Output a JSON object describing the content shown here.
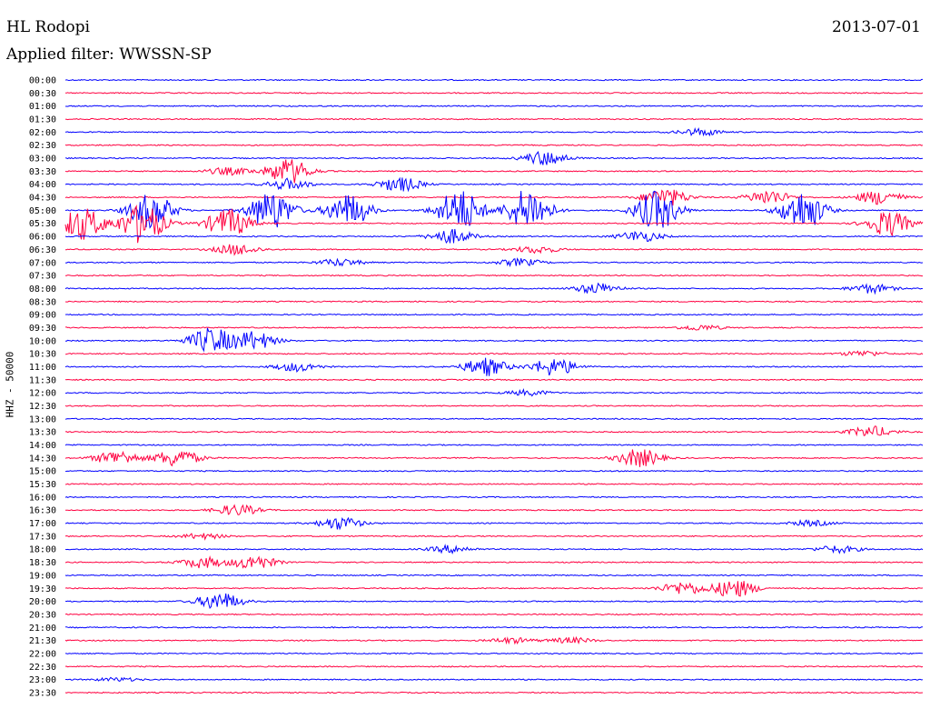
{
  "header": {
    "station": "HL Rodopi",
    "date": "2013-07-01",
    "filter": "Applied filter: WWSSN-SP"
  },
  "chart_data": {
    "type": "line",
    "title": "HL Rodopi",
    "subtitle": "Applied filter: WWSSN-SP",
    "ylabel": "HHZ - 50000",
    "xlabel": "",
    "grid": false,
    "row_colors": [
      "#0000ff",
      "#ff0040"
    ],
    "rows": [
      {
        "time": "00:00",
        "events": []
      },
      {
        "time": "00:30",
        "events": []
      },
      {
        "time": "01:00",
        "events": []
      },
      {
        "time": "01:30",
        "events": []
      },
      {
        "time": "02:00",
        "events": [
          {
            "x": 0.74,
            "a": 4
          }
        ]
      },
      {
        "time": "02:30",
        "events": []
      },
      {
        "time": "03:00",
        "events": [
          {
            "x": 0.56,
            "a": 8
          }
        ]
      },
      {
        "time": "03:30",
        "events": [
          {
            "x": 0.19,
            "a": 4
          },
          {
            "x": 0.26,
            "a": 14
          }
        ]
      },
      {
        "time": "04:00",
        "events": [
          {
            "x": 0.26,
            "a": 6
          },
          {
            "x": 0.39,
            "a": 8
          }
        ]
      },
      {
        "time": "04:30",
        "events": [
          {
            "x": 0.7,
            "a": 10
          },
          {
            "x": 0.82,
            "a": 8
          },
          {
            "x": 0.95,
            "a": 8
          }
        ]
      },
      {
        "time": "05:00",
        "events": [
          {
            "x": 0.1,
            "a": 20
          },
          {
            "x": 0.24,
            "a": 22
          },
          {
            "x": 0.33,
            "a": 18
          },
          {
            "x": 0.46,
            "a": 24
          },
          {
            "x": 0.54,
            "a": 24
          },
          {
            "x": 0.69,
            "a": 22
          },
          {
            "x": 0.86,
            "a": 22
          }
        ]
      },
      {
        "time": "05:30",
        "events": [
          {
            "x": 0.02,
            "a": 18
          },
          {
            "x": 0.09,
            "a": 22
          },
          {
            "x": 0.19,
            "a": 16
          },
          {
            "x": 0.96,
            "a": 14
          }
        ]
      },
      {
        "time": "06:00",
        "events": [
          {
            "x": 0.45,
            "a": 8
          },
          {
            "x": 0.67,
            "a": 6
          }
        ]
      },
      {
        "time": "06:30",
        "events": [
          {
            "x": 0.2,
            "a": 6
          },
          {
            "x": 0.55,
            "a": 4
          }
        ]
      },
      {
        "time": "07:00",
        "events": [
          {
            "x": 0.32,
            "a": 4
          },
          {
            "x": 0.53,
            "a": 4
          }
        ]
      },
      {
        "time": "07:30",
        "events": []
      },
      {
        "time": "08:00",
        "events": [
          {
            "x": 0.62,
            "a": 6
          },
          {
            "x": 0.94,
            "a": 5
          }
        ]
      },
      {
        "time": "08:30",
        "events": []
      },
      {
        "time": "09:00",
        "events": []
      },
      {
        "time": "09:30",
        "events": [
          {
            "x": 0.74,
            "a": 3
          }
        ]
      },
      {
        "time": "10:00",
        "events": [
          {
            "x": 0.17,
            "a": 14
          },
          {
            "x": 0.22,
            "a": 10
          }
        ]
      },
      {
        "time": "10:30",
        "events": [
          {
            "x": 0.93,
            "a": 3
          }
        ]
      },
      {
        "time": "11:00",
        "events": [
          {
            "x": 0.27,
            "a": 5
          },
          {
            "x": 0.49,
            "a": 10
          },
          {
            "x": 0.57,
            "a": 10
          }
        ]
      },
      {
        "time": "11:30",
        "events": []
      },
      {
        "time": "12:00",
        "events": [
          {
            "x": 0.54,
            "a": 3
          }
        ]
      },
      {
        "time": "12:30",
        "events": []
      },
      {
        "time": "13:00",
        "events": []
      },
      {
        "time": "13:30",
        "events": [
          {
            "x": 0.94,
            "a": 6
          }
        ]
      },
      {
        "time": "14:00",
        "events": []
      },
      {
        "time": "14:30",
        "events": [
          {
            "x": 0.06,
            "a": 8
          },
          {
            "x": 0.13,
            "a": 10
          },
          {
            "x": 0.67,
            "a": 10
          }
        ]
      },
      {
        "time": "15:00",
        "events": []
      },
      {
        "time": "15:30",
        "events": []
      },
      {
        "time": "16:00",
        "events": []
      },
      {
        "time": "16:30",
        "events": [
          {
            "x": 0.2,
            "a": 6
          }
        ]
      },
      {
        "time": "17:00",
        "events": [
          {
            "x": 0.32,
            "a": 7
          },
          {
            "x": 0.87,
            "a": 3
          }
        ]
      },
      {
        "time": "17:30",
        "events": [
          {
            "x": 0.16,
            "a": 3
          }
        ]
      },
      {
        "time": "18:00",
        "events": [
          {
            "x": 0.45,
            "a": 4
          },
          {
            "x": 0.9,
            "a": 4
          }
        ]
      },
      {
        "time": "18:30",
        "events": [
          {
            "x": 0.16,
            "a": 6
          },
          {
            "x": 0.22,
            "a": 8
          }
        ]
      },
      {
        "time": "19:00",
        "events": []
      },
      {
        "time": "19:30",
        "events": [
          {
            "x": 0.72,
            "a": 7
          },
          {
            "x": 0.78,
            "a": 10
          }
        ]
      },
      {
        "time": "20:00",
        "events": [
          {
            "x": 0.18,
            "a": 10
          }
        ]
      },
      {
        "time": "20:30",
        "events": []
      },
      {
        "time": "21:00",
        "events": []
      },
      {
        "time": "21:30",
        "events": [
          {
            "x": 0.52,
            "a": 3
          },
          {
            "x": 0.59,
            "a": 3
          }
        ]
      },
      {
        "time": "22:00",
        "events": []
      },
      {
        "time": "22:30",
        "events": []
      },
      {
        "time": "23:00",
        "events": [
          {
            "x": 0.06,
            "a": 2
          }
        ]
      },
      {
        "time": "23:30",
        "events": []
      }
    ]
  }
}
